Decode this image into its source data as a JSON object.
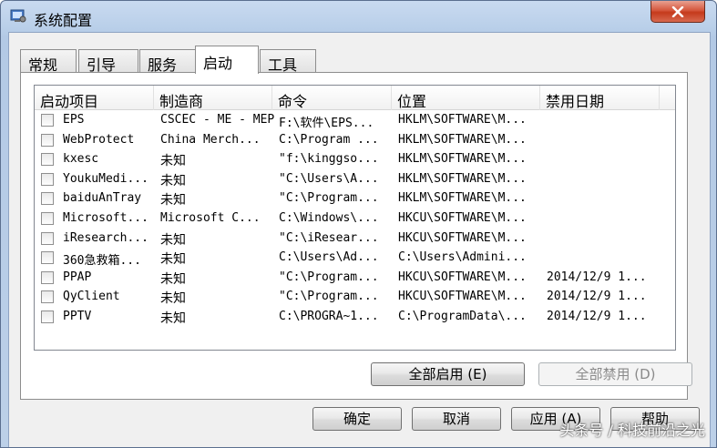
{
  "window": {
    "title": "系统配置"
  },
  "tabs": [
    {
      "label": "常规"
    },
    {
      "label": "引导"
    },
    {
      "label": "服务"
    },
    {
      "label": "启动"
    },
    {
      "label": "工具"
    }
  ],
  "list": {
    "columns": [
      "启动项目",
      "制造商",
      "命令",
      "位置",
      "禁用日期"
    ],
    "rows": [
      {
        "item": "EPS",
        "maker": "CSCEC - ME - MEP",
        "command": "F:\\软件\\EPS...",
        "location": "HKLM\\SOFTWARE\\M...",
        "date": ""
      },
      {
        "item": "WebProtect",
        "maker": "China Merch...",
        "command": "C:\\Program ...",
        "location": "HKLM\\SOFTWARE\\M...",
        "date": ""
      },
      {
        "item": "kxesc",
        "maker": "未知",
        "command": "\"f:\\kinggso...",
        "location": "HKLM\\SOFTWARE\\M...",
        "date": ""
      },
      {
        "item": "YoukuMedi...",
        "maker": "未知",
        "command": "\"C:\\Users\\A...",
        "location": "HKLM\\SOFTWARE\\M...",
        "date": ""
      },
      {
        "item": "baiduAnTray",
        "maker": "未知",
        "command": "\"C:\\Program...",
        "location": "HKLM\\SOFTWARE\\M...",
        "date": ""
      },
      {
        "item": "Microsoft...",
        "maker": "Microsoft C...",
        "command": "C:\\Windows\\...",
        "location": "HKCU\\SOFTWARE\\M...",
        "date": ""
      },
      {
        "item": "iResearch...",
        "maker": "未知",
        "command": "\"C:\\iResear...",
        "location": "HKCU\\SOFTWARE\\M...",
        "date": ""
      },
      {
        "item": "360急救箱...",
        "maker": "未知",
        "command": "C:\\Users\\Ad...",
        "location": "C:\\Users\\Admini...",
        "date": ""
      },
      {
        "item": "PPAP",
        "maker": "未知",
        "command": "\"C:\\Program...",
        "location": "HKCU\\SOFTWARE\\M...",
        "date": "2014/12/9 1..."
      },
      {
        "item": "QyClient",
        "maker": "未知",
        "command": "\"C:\\Program...",
        "location": "HKCU\\SOFTWARE\\M...",
        "date": "2014/12/9 1..."
      },
      {
        "item": "PPTV",
        "maker": "未知",
        "command": "C:\\PROGRA~1...",
        "location": "C:\\ProgramData\\...",
        "date": "2014/12/9 1..."
      }
    ]
  },
  "buttons": {
    "enable_all": "全部启用 (E)",
    "disable_all": "全部禁用 (D)",
    "ok": "确定",
    "cancel": "取消",
    "apply": "应用 (A)",
    "help": "帮助"
  },
  "watermark": "头条号 / 科技前沿之光"
}
